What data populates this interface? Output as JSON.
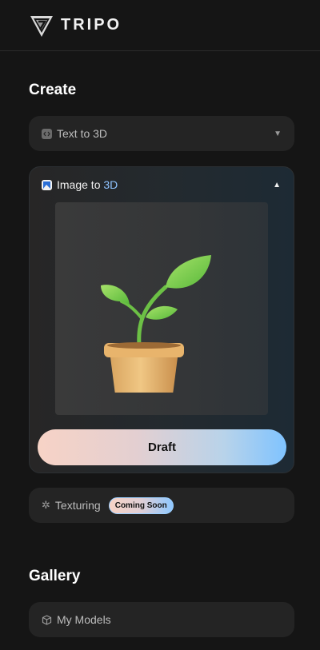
{
  "brand": {
    "name": "TRIPO"
  },
  "create": {
    "title": "Create",
    "text_to_3d": {
      "label": "Text to 3D",
      "icon": "code-icon",
      "state": "collapsed"
    },
    "image_to_3d": {
      "label_prefix": "Image to ",
      "label_accent": "3D",
      "icon": "image-icon",
      "state": "expanded",
      "preview": "potted-plant-image",
      "button_label": "Draft"
    },
    "texturing": {
      "label": "Texturing",
      "icon": "texture-icon",
      "badge": "Coming Soon"
    }
  },
  "gallery": {
    "title": "Gallery",
    "my_models": {
      "label": "My Models",
      "icon": "cube-icon"
    }
  },
  "colors": {
    "background": "#151515",
    "card": "#242424",
    "accent_blue": "#8fc3ff",
    "gradient_start": "#f7d3c6",
    "gradient_end": "#7fc3ff"
  }
}
